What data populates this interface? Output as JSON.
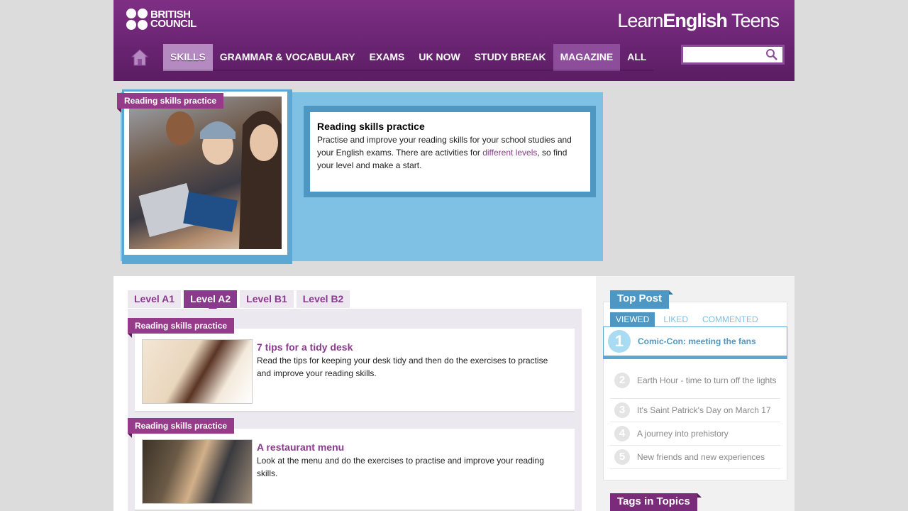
{
  "header": {
    "logo_line1": "BRITISH",
    "logo_line2": "COUNCIL",
    "site_title_part1": "Learn",
    "site_title_part2": "English",
    "site_title_part3": " Teens"
  },
  "nav": {
    "items": [
      {
        "label": "SKILLS"
      },
      {
        "label": "GRAMMAR & VOCABULARY"
      },
      {
        "label": "EXAMS"
      },
      {
        "label": "UK NOW"
      },
      {
        "label": "STUDY BREAK"
      },
      {
        "label": "MAGAZINE"
      },
      {
        "label": "ALL"
      }
    ]
  },
  "hero": {
    "ribbon": "Reading skills practice",
    "title": "Reading skills practice",
    "text_before_link": "Practise and improve your reading skills for your school studies and your English exams. There are activities for ",
    "link": "different levels",
    "text_after_link": ", so find your level and make a start."
  },
  "levels": {
    "tabs": [
      {
        "label": "Level A1"
      },
      {
        "label": "Level A2"
      },
      {
        "label": "Level B1"
      },
      {
        "label": "Level B2"
      }
    ]
  },
  "items": [
    {
      "ribbon": "Reading skills practice",
      "title": "7 tips for a tidy desk",
      "desc": "Read the tips for keeping your desk tidy and then do the exercises to practise and improve your reading skills."
    },
    {
      "ribbon": "Reading skills practice",
      "title": "A restaurant menu",
      "desc": "Look at the menu and do the exercises to practise and improve your reading skills."
    }
  ],
  "sidebar": {
    "top_post_heading": "Top Post",
    "tabs": [
      {
        "label": "VIEWED"
      },
      {
        "label": "LIKED"
      },
      {
        "label": "COMMENTED"
      }
    ],
    "posts": [
      {
        "num": "1",
        "title": "Comic-Con: meeting the fans"
      },
      {
        "num": "2",
        "title": "Earth Hour - time to turn off the lights"
      },
      {
        "num": "3",
        "title": "It's Saint Patrick's Day on March 17"
      },
      {
        "num": "4",
        "title": "A journey into prehistory"
      },
      {
        "num": "5",
        "title": "New friends and new experiences"
      }
    ],
    "tags_heading": "Tags in Topics"
  }
}
